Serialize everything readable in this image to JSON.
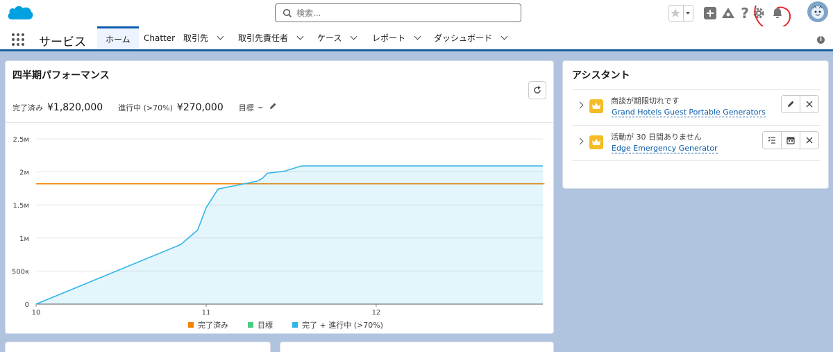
{
  "header": {
    "search_placeholder": "検索..."
  },
  "nav": {
    "app_name": "サービス",
    "tabs": [
      {
        "label": "ホーム",
        "active": true,
        "dropdown": false
      },
      {
        "label": "Chatter",
        "active": false,
        "dropdown": false
      },
      {
        "label": "取引先",
        "active": false,
        "dropdown": true
      },
      {
        "label": "取引先責任者",
        "active": false,
        "dropdown": true
      },
      {
        "label": "ケース",
        "active": false,
        "dropdown": true
      },
      {
        "label": "レポート",
        "active": false,
        "dropdown": true
      },
      {
        "label": "ダッシュボード",
        "active": false,
        "dropdown": true
      }
    ]
  },
  "performance": {
    "title": "四半期パフォーマンス",
    "closed_label": "完了済み",
    "closed_value": "¥1,820,000",
    "open_label": "進行中 (>70%)",
    "open_value": "¥270,000",
    "goal_label": "目標",
    "goal_value": "–"
  },
  "chart_data": {
    "type": "line",
    "x_tick_labels": [
      "10",
      "11",
      "12"
    ],
    "y_tick_labels": [
      "0",
      "500к",
      "1м",
      "1.5м",
      "2м",
      "2.5м"
    ],
    "ylim": [
      0,
      2500000
    ],
    "legend_placement": "bottom",
    "series": [
      {
        "name": "完了済み",
        "color": "#f38303",
        "kind": "line",
        "x": [
          10,
          12.99
        ],
        "y": [
          1820000,
          1820000
        ]
      },
      {
        "name": "目標",
        "color": "#4bca81",
        "kind": "line",
        "x": [],
        "y": []
      },
      {
        "name": "完了 + 進行中 (>70%)",
        "color": "#2fb5ea",
        "kind": "area",
        "x": [
          10,
          10.85,
          10.95,
          11.0,
          11.07,
          11.3,
          11.33,
          11.36,
          11.46,
          11.56,
          12.0,
          12.98
        ],
        "y": [
          0,
          900000,
          1120000,
          1460000,
          1740000,
          1860000,
          1900000,
          1980000,
          2010000,
          2090000,
          2090000,
          2090000
        ]
      }
    ]
  },
  "assistant": {
    "title": "アシスタント",
    "items": [
      {
        "title": "商談が期限切れです",
        "link": "Grand Hotels Guest Portable Generators"
      },
      {
        "title": "活動が 30 日間ありません",
        "link": "Edge Emergency Generator"
      }
    ]
  },
  "colors": {
    "brand": "#0b5cab",
    "annotation": "#e5252a"
  }
}
